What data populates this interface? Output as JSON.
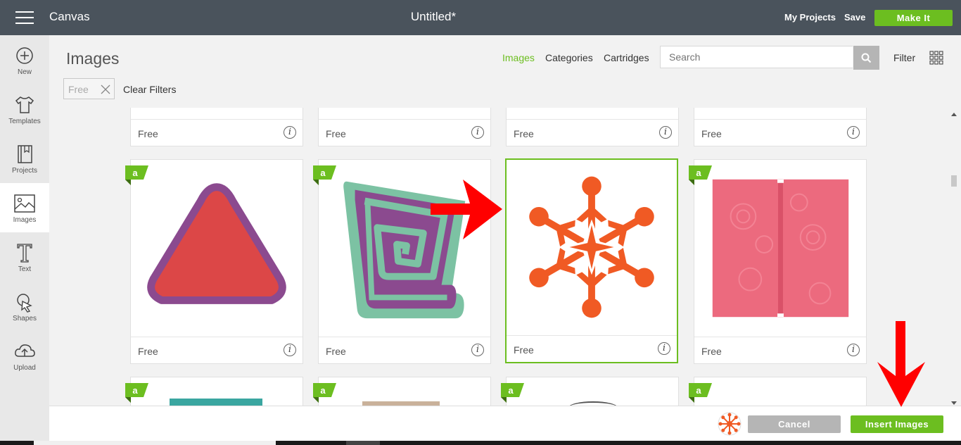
{
  "topbar": {
    "app_title": "Canvas",
    "doc_title": "Untitled*",
    "my_projects": "My Projects",
    "save": "Save",
    "make_it": "Make It"
  },
  "sidebar": {
    "items": [
      {
        "label": "New",
        "icon": "plus-circle-icon"
      },
      {
        "label": "Templates",
        "icon": "tshirt-icon"
      },
      {
        "label": "Projects",
        "icon": "notebook-icon"
      },
      {
        "label": "Images",
        "icon": "image-icon",
        "active": true
      },
      {
        "label": "Text",
        "icon": "text-icon"
      },
      {
        "label": "Shapes",
        "icon": "shapes-icon"
      },
      {
        "label": "Upload",
        "icon": "upload-cloud-icon"
      }
    ]
  },
  "panel": {
    "title": "Images",
    "tabs": [
      "Images",
      "Categories",
      "Cartridges"
    ],
    "active_tab": "Images",
    "search_placeholder": "Search",
    "filter_label": "Filter",
    "filter_chip": "Free",
    "clear_filters": "Clear Filters"
  },
  "cards": {
    "price_label": "Free",
    "row2": [
      {
        "image": "triangle",
        "colors": {
          "fill": "#dc4747",
          "outline": "#8b4a8f"
        }
      },
      {
        "image": "spiral",
        "colors": {
          "fill": "#8b4a8f",
          "outline": "#7cc2a3"
        }
      },
      {
        "image": "snowflake",
        "colors": {
          "fill": "#f05a24"
        },
        "selected": true
      },
      {
        "image": "floral-card",
        "colors": {
          "fill": "#ec6a7e"
        }
      }
    ]
  },
  "bottombar": {
    "cancel": "Cancel",
    "insert": "Insert Images"
  },
  "colors": {
    "topbar": "#4a535c",
    "accent": "#6cbe20",
    "annotation_arrow": "#ff0000"
  }
}
